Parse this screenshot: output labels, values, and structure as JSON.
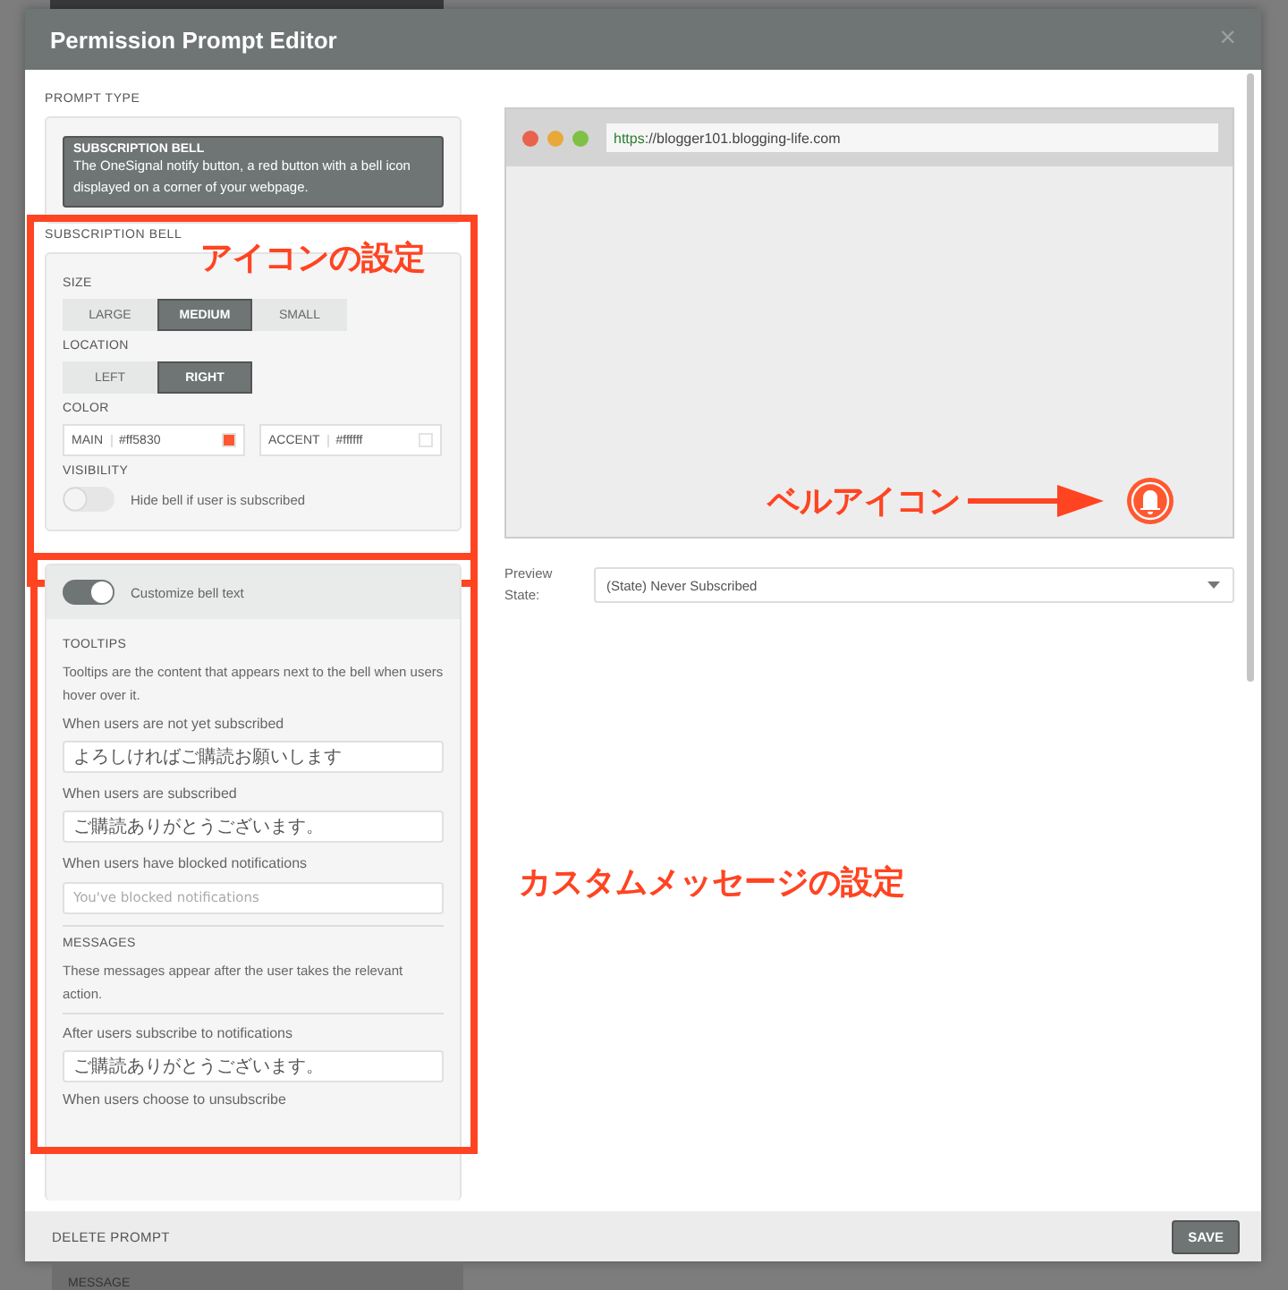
{
  "window": {
    "title": "Permission Prompt Editor",
    "close": "×"
  },
  "prompt_type": {
    "heading": "PROMPT TYPE",
    "card_title": "SUBSCRIPTION BELL",
    "card_text": "The OneSignal notify button, a red button with a bell icon displayed on a corner of your webpage."
  },
  "bell": {
    "heading": "SUBSCRIPTION BELL",
    "size": {
      "label": "SIZE",
      "options": [
        {
          "label": "LARGE",
          "selected": false
        },
        {
          "label": "MEDIUM",
          "selected": true
        },
        {
          "label": "SMALL",
          "selected": false
        }
      ]
    },
    "location": {
      "label": "LOCATION",
      "options": [
        {
          "label": "LEFT",
          "selected": false
        },
        {
          "label": "RIGHT",
          "selected": true
        }
      ]
    },
    "color": {
      "label": "COLOR",
      "fields": [
        {
          "label": "MAIN",
          "value": "#ff5830",
          "color": "#ff5830"
        },
        {
          "label": "ACCENT",
          "value": "#ffffff",
          "color": "#ffffff"
        }
      ]
    },
    "visibility": {
      "label": "VISIBILITY",
      "toggle": {
        "label": "Hide bell if user is subscribed",
        "on": false
      }
    }
  },
  "custom_text": {
    "toggle": {
      "label": "Customize bell text",
      "on": true
    },
    "sections": [
      {
        "heading": "TOOLTIPS",
        "description": "Tooltips are the content that appears next to the bell when users hover over it.",
        "fields": [
          {
            "label": "When users are not yet subscribed",
            "value": "よろしければご購読お願いします"
          },
          {
            "label": "When users are subscribed",
            "value": "ご購読ありがとうございます。"
          },
          {
            "label": "When users have blocked notifications",
            "placeholder": "You've blocked notifications"
          }
        ]
      },
      {
        "heading": "MESSAGES",
        "description": "These messages appear after the user takes the relevant action.",
        "fields": [
          {
            "label": "After users subscribe to notifications",
            "value": "ご購読ありがとうございます。"
          }
        ]
      }
    ],
    "cut_label": "When users choose to unsubscribe"
  },
  "preview": {
    "url_scheme": "https",
    "url_rest": "://blogger101.blogging-life.com",
    "state_label": "Preview State:",
    "state_value": "(State) Never Subscribed"
  },
  "annotations": {
    "icon_settings": "アイコンの設定",
    "bell_icon": "ベルアイコン",
    "message_settings": "カスタムメッセージの設定"
  },
  "footer": {
    "delete": "DELETE PROMPT",
    "save": "SAVE"
  },
  "background": {
    "label": "MESSAGE"
  }
}
